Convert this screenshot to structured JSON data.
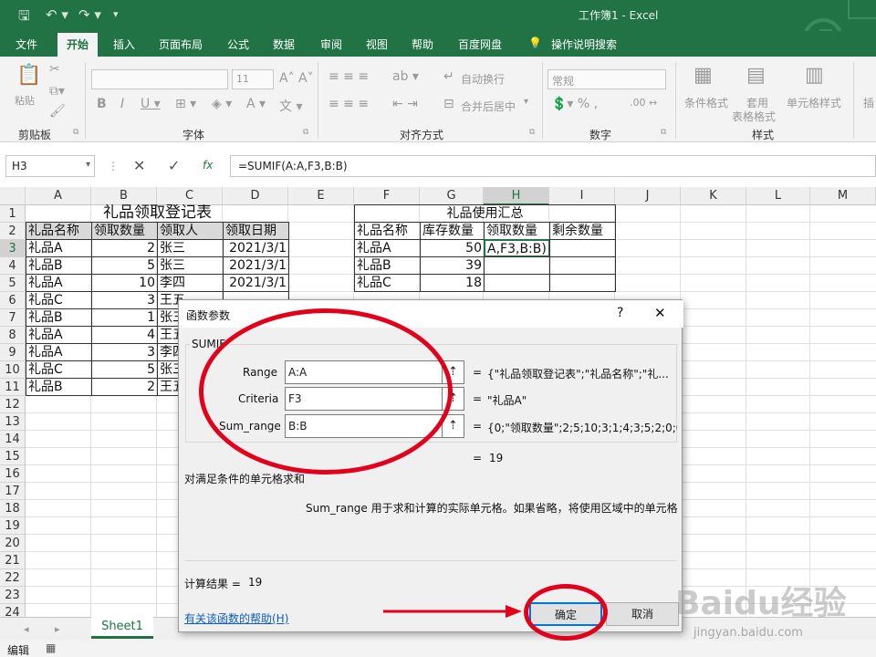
{
  "app": {
    "title": "工作簿1  -  Excel"
  },
  "tabs": [
    "文件",
    "开始",
    "插入",
    "页面布局",
    "公式",
    "数据",
    "审阅",
    "视图",
    "帮助",
    "百度网盘",
    "操作说明搜索"
  ],
  "ribbon": {
    "groups": [
      "剪贴板",
      "字体",
      "对齐方式",
      "数字",
      "样式"
    ],
    "paste": "粘贴",
    "font_size": "11",
    "wrap": "自动换行",
    "merge": "合并后居中",
    "num_format": "常规",
    "cond_format": "条件格式",
    "table_format_1": "套用",
    "table_format_2": "表格格式",
    "cell_style": "单元格样式",
    "insert": "插"
  },
  "formula": {
    "name_box": "H3",
    "fx": "fx",
    "content": "=SUMIF(A:A,F3,B:B)"
  },
  "columns": [
    "A",
    "B",
    "C",
    "D",
    "E",
    "F",
    "G",
    "H",
    "I",
    "J",
    "K",
    "L",
    "M"
  ],
  "rows": [
    "1",
    "2",
    "3",
    "4",
    "5",
    "6",
    "7",
    "8",
    "9",
    "10",
    "11",
    "12",
    "13",
    "14",
    "15",
    "16",
    "17",
    "18",
    "19",
    "20",
    "21",
    "22",
    "23",
    "24"
  ],
  "table1": {
    "title": "礼品领取登记表",
    "headers": [
      "礼品名称",
      "领取数量",
      "领取人",
      "领取日期"
    ],
    "rows": [
      [
        "礼品A",
        "2",
        "张三",
        "2021/3/1"
      ],
      [
        "礼品B",
        "5",
        "张三",
        "2021/3/1"
      ],
      [
        "礼品A",
        "10",
        "李四",
        "2021/3/1"
      ],
      [
        "礼品C",
        "3",
        "王五",
        ""
      ],
      [
        "礼品B",
        "1",
        "张三",
        ""
      ],
      [
        "礼品A",
        "4",
        "王五",
        ""
      ],
      [
        "礼品A",
        "3",
        "李四",
        ""
      ],
      [
        "礼品C",
        "5",
        "张三",
        ""
      ],
      [
        "礼品B",
        "2",
        "王五",
        ""
      ]
    ]
  },
  "table2": {
    "title": "礼品使用汇总",
    "headers": [
      "礼品名称",
      "库存数量",
      "领取数量",
      "剩余数量"
    ],
    "rows": [
      [
        "礼品A",
        "50",
        "A,F3,B:B)",
        ""
      ],
      [
        "礼品B",
        "39",
        "",
        ""
      ],
      [
        "礼品C",
        "18",
        "",
        ""
      ]
    ]
  },
  "sheet": {
    "tab": "Sheet1"
  },
  "status": {
    "mode": "编辑"
  },
  "dialog": {
    "title": "函数参数",
    "help_q": "?",
    "close": "✕",
    "function": "SUMIF",
    "args": [
      {
        "label": "Range",
        "value": "A:A",
        "result": "{\"礼品领取登记表\";\"礼品名称\";\"礼..."
      },
      {
        "label": "Criteria",
        "value": "F3",
        "result": "\"礼品A\""
      },
      {
        "label": "Sum_range",
        "value": "B:B",
        "result": "{0;\"领取数量\";2;5;10;3;1;4;3;5;2;0;0;0"
      }
    ],
    "eq": "=",
    "total": "19",
    "desc": "对满足条件的单元格求和",
    "arg_desc": "Sum_range  用于求和计算的实际单元格。如果省略，将使用区域中的单元格",
    "calc_label": "计算结果 =",
    "calc_value": "19",
    "help_link": "有关该函数的帮助(H)",
    "ok": "确定",
    "cancel": "取消"
  },
  "watermark": {
    "brand": "Baidu经验",
    "url": "jingyan.baidu.com"
  },
  "colors": {
    "excel_green": "#217346",
    "annotation_red": "#e3001b",
    "link_blue": "#0b5fc4"
  }
}
